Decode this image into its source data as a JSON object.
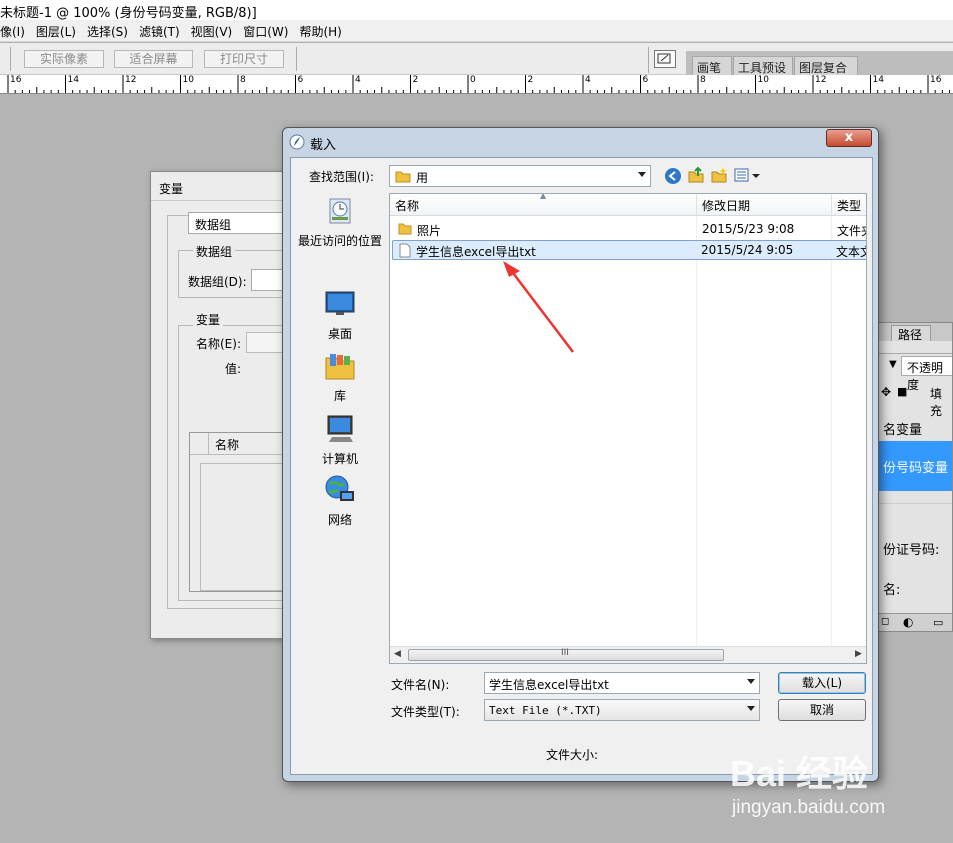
{
  "app": {
    "title": "未标题-1 @ 100% (身份号码变量, RGB/8)]"
  },
  "menu": [
    "像(I)",
    "图层(L)",
    "选择(S)",
    "滤镜(T)",
    "视图(V)",
    "窗口(W)",
    "帮助(H)"
  ],
  "options_bar": {
    "buttons": [
      "实际像素",
      "适合屏幕",
      "打印尺寸"
    ],
    "palette_tabs": [
      "画笔",
      "工具预设",
      "图层复合"
    ]
  },
  "ruler": {
    "labels": [
      "16",
      "14",
      "12",
      "10",
      "8",
      "6",
      "4",
      "2",
      "0",
      "2",
      "4",
      "6",
      "8",
      "10",
      "12",
      "14",
      "16"
    ]
  },
  "variables_dialog": {
    "title": "变量",
    "dataset_combo": "数据组",
    "dataset_group": "数据组",
    "dataset_label": "数据组(D):",
    "variable_group": "变量",
    "name_label": "名称(E):",
    "value_label": "值:",
    "list_header": "名称"
  },
  "right_panel": {
    "tab": "路径",
    "opacity_label": "不透明度",
    "fill_label": "填充",
    "layer1": "名变量",
    "layer2": "份号码变量",
    "field1": "份证号码:",
    "field2": "名:"
  },
  "load_dialog": {
    "title": "载入",
    "close": "x",
    "look_in_label": "查找范围(I):",
    "look_in_value": "用",
    "places": [
      {
        "label": "最近访问的位置",
        "icon": "recent-places-icon"
      },
      {
        "label": "桌面",
        "icon": "desktop-icon"
      },
      {
        "label": "库",
        "icon": "libraries-icon"
      },
      {
        "label": "计算机",
        "icon": "computer-icon"
      },
      {
        "label": "网络",
        "icon": "network-icon"
      }
    ],
    "columns": [
      "名称",
      "修改日期",
      "类型"
    ],
    "files": [
      {
        "name": "照片",
        "date": "2015/5/23 9:08",
        "type": "文件夹",
        "icon": "folder-icon"
      },
      {
        "name": "学生信息excel导出txt",
        "date": "2015/5/24 9:05",
        "type": "文本文",
        "icon": "text-file-icon"
      }
    ],
    "filename_label": "文件名(N):",
    "filename_value": "学生信息excel导出txt",
    "filetype_label": "文件类型(T):",
    "filetype_value": "Text File (*.TXT)",
    "load_button": "载入(L)",
    "cancel_button": "取消",
    "filesize_label": "文件大小:"
  },
  "watermark": {
    "line1": "Bai  经验",
    "line2": "jingyan.baidu.com"
  },
  "colors": {
    "accent": "#3399ff",
    "arrow": "#ee3333",
    "selection": "#cce8ff"
  }
}
